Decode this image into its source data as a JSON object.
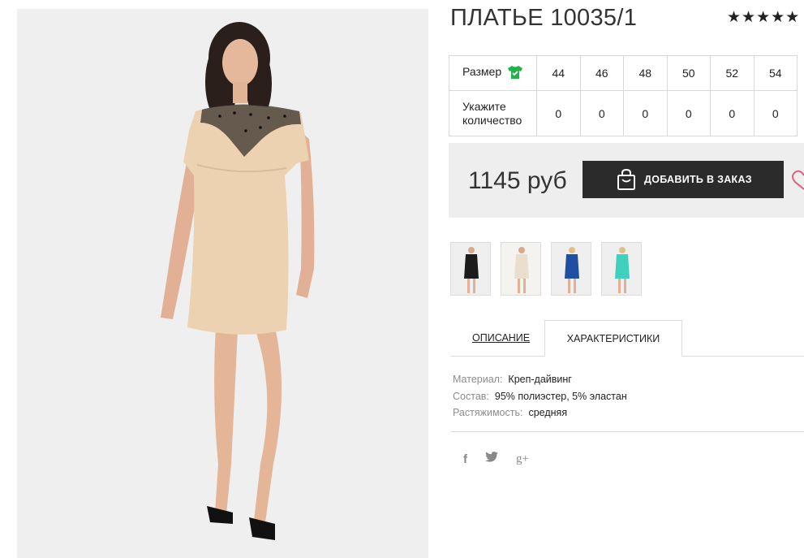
{
  "product": {
    "title": "ПЛАТЬЕ 10035/1",
    "rating_stars": "★★★★★",
    "main_image": "model-beige-dress-photo"
  },
  "sizes": {
    "row_label": "Размер",
    "qty_label": "Укажите количество",
    "size_icon": "tshirt-check-icon",
    "items": [
      {
        "size": "44",
        "qty": "0"
      },
      {
        "size": "46",
        "qty": "0"
      },
      {
        "size": "48",
        "qty": "0"
      },
      {
        "size": "50",
        "qty": "0"
      },
      {
        "size": "52",
        "qty": "0"
      },
      {
        "size": "54",
        "qty": "0"
      }
    ]
  },
  "purchase": {
    "price": "1145 руб",
    "add_button_label": "ДОБАВИТЬ В ЗАКАЗ",
    "button_icon": "shopping-bag-icon",
    "wishlist_icon": "heart-icon"
  },
  "thumbnails": [
    {
      "name": "black-dress",
      "color": "#1c1c1c"
    },
    {
      "name": "beige-dress",
      "color": "#eadfcf"
    },
    {
      "name": "blue-dress",
      "color": "#1f4fa0"
    },
    {
      "name": "turquoise-dress",
      "color": "#3fd1bd"
    }
  ],
  "tabs": {
    "description": "ОПИСАНИЕ",
    "characteristics": "ХАРАКТЕРИСТИКИ",
    "active": "characteristics"
  },
  "specs": [
    {
      "key": "Материал:",
      "value": "Креп-дайвинг"
    },
    {
      "key": "Состав:",
      "value": "95% полиэстер, 5% эластан"
    },
    {
      "key": "Растяжимость:",
      "value": "средняя"
    }
  ],
  "social": {
    "facebook": "f",
    "twitter": "t",
    "google_plus": "g+"
  },
  "colors": {
    "button_bg": "#2b2b2b",
    "price_box_bg": "#eeeeee",
    "size_icon": "#22b14c",
    "heart": "#e0607e"
  }
}
